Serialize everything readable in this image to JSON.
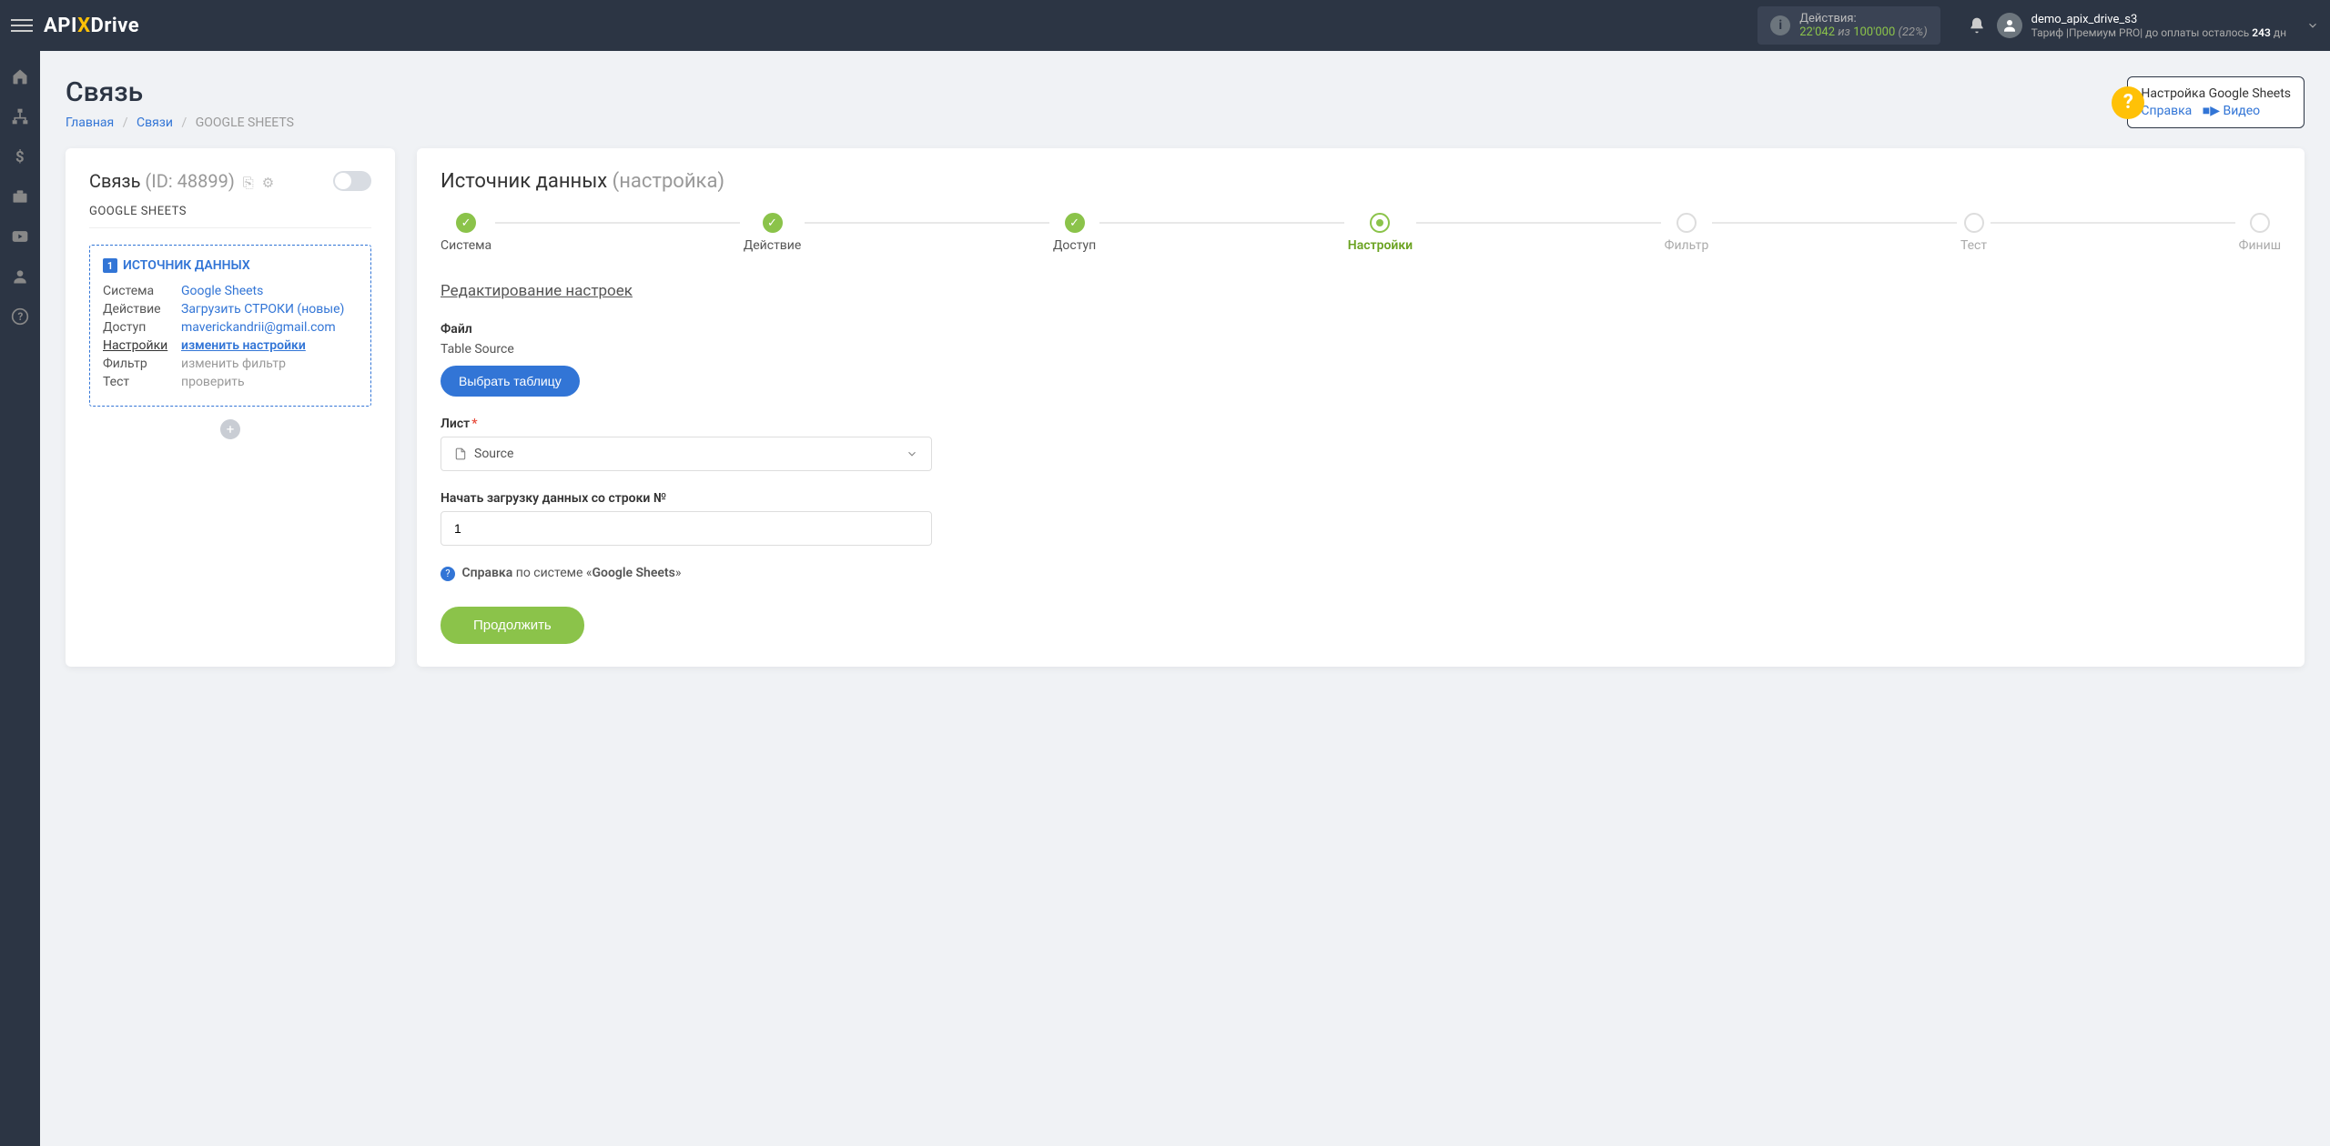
{
  "topbar": {
    "logo_parts": {
      "api": "API",
      "x": "X",
      "drive": "Drive"
    },
    "actions": {
      "label": "Действия:",
      "used": "22'042",
      "of_word": "из",
      "total": "100'000",
      "percent": "(22%)"
    },
    "user": {
      "name": "demo_apix_drive_s3",
      "plan_prefix": "Тариф |Премиум PRO| до оплаты осталось ",
      "plan_days": "243",
      "plan_suffix": " дн"
    }
  },
  "page": {
    "title": "Связь",
    "breadcrumb": {
      "home": "Главная",
      "links": "Связи",
      "current": "GOOGLE SHEETS"
    }
  },
  "help_popover": {
    "title": "Настройка Google Sheets",
    "ref_link": "Справка",
    "video_link": "Видео"
  },
  "left_card": {
    "title": "Связь",
    "id_label": "(ID: 48899)",
    "subtitle": "GOOGLE SHEETS",
    "source_badge": "1",
    "source_title": "ИСТОЧНИК ДАННЫХ",
    "rows": {
      "system": {
        "k": "Система",
        "v": "Google Sheets"
      },
      "action": {
        "k": "Действие",
        "v": "Загрузить СТРОКИ (новые)"
      },
      "access": {
        "k": "Доступ",
        "v": "maverickandrii@gmail.com"
      },
      "settings": {
        "k": "Настройки",
        "v": "изменить настройки"
      },
      "filter": {
        "k": "Фильтр",
        "v": "изменить фильтр"
      },
      "test": {
        "k": "Тест",
        "v": "проверить"
      }
    }
  },
  "right_card": {
    "heading_main": "Источник данных",
    "heading_sub": "(настройка)",
    "steps": [
      "Система",
      "Действие",
      "Доступ",
      "Настройки",
      "Фильтр",
      "Тест",
      "Финиш"
    ],
    "section_title": "Редактирование настроек",
    "file": {
      "label": "Файл",
      "value": "Table Source",
      "button": "Выбрать таблицу"
    },
    "sheet": {
      "label": "Лист",
      "selected": "Source"
    },
    "start_row": {
      "label": "Начать загрузку данных со строки №",
      "value": "1"
    },
    "help_text": {
      "prefix": "Справка",
      "mid": " по системе «",
      "system": "Google Sheets",
      "suffix": "»"
    },
    "continue": "Продолжить"
  }
}
